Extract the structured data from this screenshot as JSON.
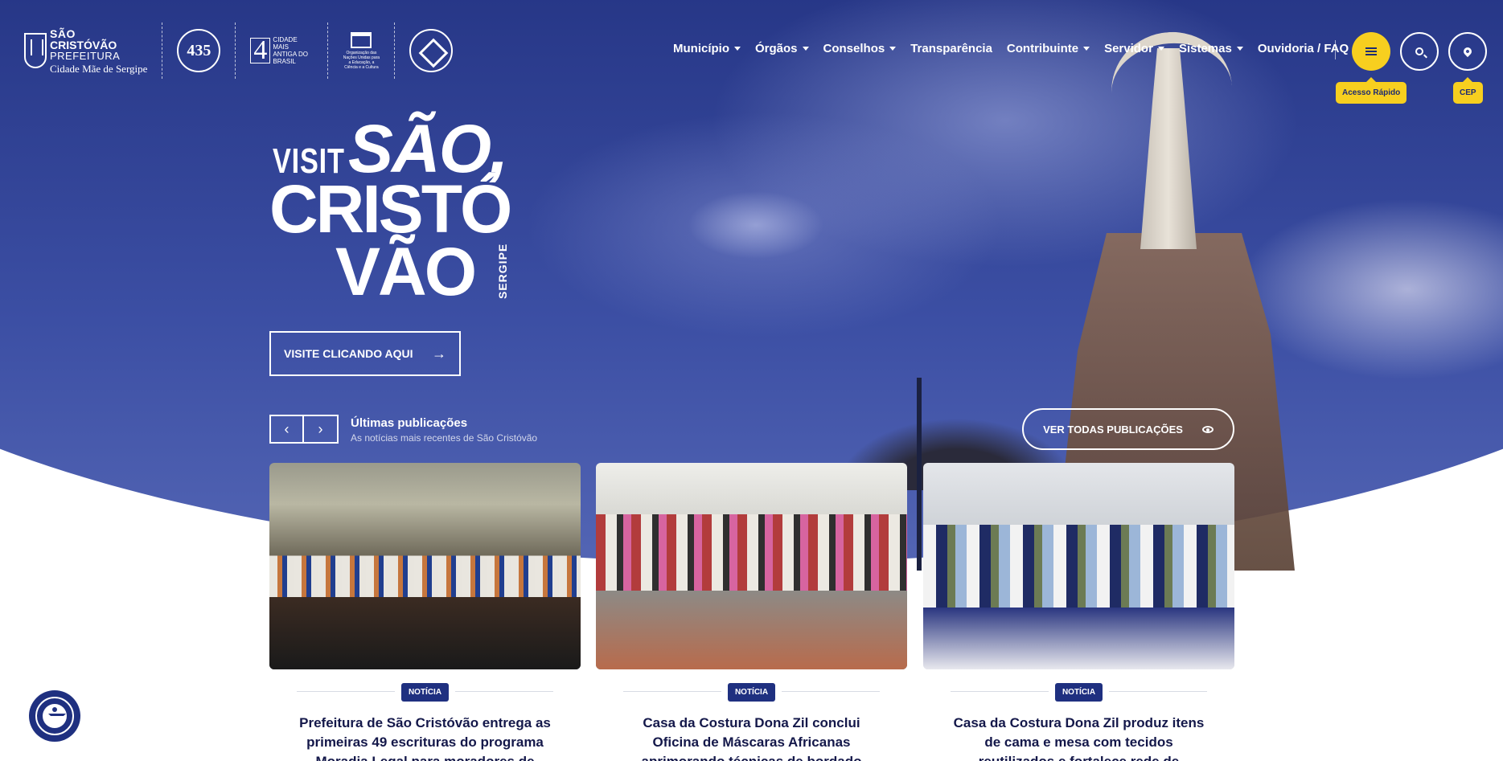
{
  "header": {
    "logo": {
      "line1": "SÃO",
      "line2": "CRISTÓVÃO",
      "line3": "PREFEITURA",
      "line4": "Cidade Mãe de Sergipe"
    },
    "badge_435": "435",
    "badge_4_number": "4",
    "badge_4_text": "CIDADE MAIS ANTIGA DO BRASIL",
    "unesco_text": "Organização das Nações Unidas para a Educação, a Ciência e a Cultura"
  },
  "nav": {
    "items": [
      {
        "label": "Município",
        "dropdown": true
      },
      {
        "label": "Órgãos",
        "dropdown": true
      },
      {
        "label": "Conselhos",
        "dropdown": true
      },
      {
        "label": "Transparência",
        "dropdown": false
      },
      {
        "label": "Contribuinte",
        "dropdown": true
      },
      {
        "label": "Servidor",
        "dropdown": true
      },
      {
        "label": "Sistemas",
        "dropdown": true
      },
      {
        "label": "Ouvidoria / FAQ",
        "dropdown": false
      }
    ]
  },
  "actions": {
    "menu_tooltip": "Acesso Rápido",
    "cep_tooltip": "CEP",
    "menu_icon": "hamburger-icon",
    "search_icon": "search-icon",
    "cep_icon": "map-pin-icon"
  },
  "hero": {
    "visit_small": "VISIT",
    "visit_line1": "SÃO,",
    "visit_line2": "CRISTÓ",
    "visit_line3": "VÃO",
    "visit_vertical": "SERGIPE",
    "visit_button": "VISITE CLICANDO AQUI"
  },
  "publications": {
    "title": "Últimas publicações",
    "subtitle": "As notícias mais recentes de São Cristóvão",
    "prev_icon": "chevron-left-icon",
    "next_icon": "chevron-right-icon",
    "view_all": "VER TODAS PUBLICAÇÕES",
    "cards": [
      {
        "tag": "NOTÍCIA",
        "title": "Prefeitura de São Cristóvão entrega as primeiras 49 escrituras do programa Moradia Legal para moradores de"
      },
      {
        "tag": "NOTÍCIA",
        "title": "Casa da Costura Dona Zil conclui Oficina de Máscaras Africanas aprimorando técnicas de bordado"
      },
      {
        "tag": "NOTÍCIA",
        "title": "Casa da Costura Dona Zil produz itens de cama e mesa com tecidos reutilizados e fortalece rede de"
      }
    ]
  },
  "colors": {
    "primary": "#1f3080",
    "accent": "#f7cf1f",
    "title_text": "#14184a"
  }
}
